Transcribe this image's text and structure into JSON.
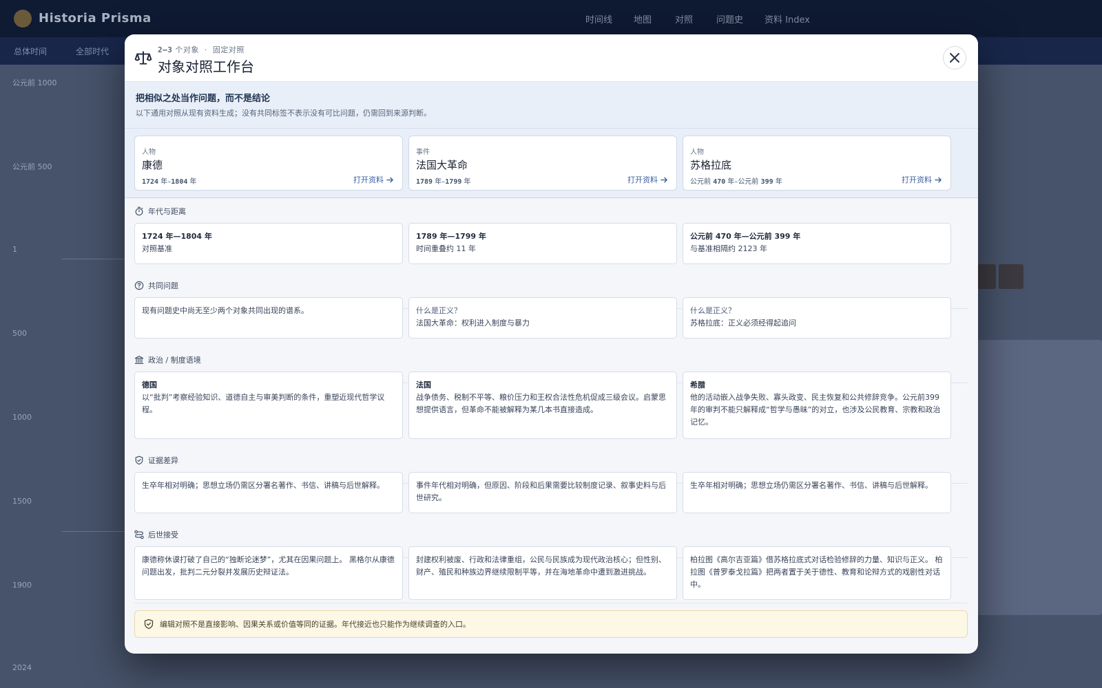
{
  "background": {
    "app_name": "Historia Prisma",
    "nav": [
      "时间线",
      "地图",
      "对照",
      "问题史",
      "资料 Index"
    ],
    "subnav": [
      "总体时间",
      "全部时代"
    ],
    "year_labels": [
      "公元前 1000",
      "公元前 500",
      "1",
      "500",
      "1000",
      "1500",
      "1900",
      "2024"
    ]
  },
  "modal": {
    "eyebrow_count": "2–3",
    "eyebrow_unit": "个对象",
    "eyebrow_sep": "·",
    "eyebrow_mode": "固定对照",
    "title": "对象对照工作台",
    "notice": {
      "title": "把相似之处当作问题，而不是结论",
      "subtitle": "以下通用对照从现有资料生成；没有共同标签不表示没有可比问题，仍需回到来源判断。"
    },
    "open_label": "打开资料",
    "subjects": [
      {
        "type": "人物",
        "name": "康德",
        "start_prefix": "",
        "start": "1724",
        "sep1": " 年–",
        "end_prefix": "",
        "end": "1804",
        "sep2": " 年"
      },
      {
        "type": "事件",
        "name": "法国大革命",
        "start_prefix": "",
        "start": "1789",
        "sep1": " 年–",
        "end_prefix": "",
        "end": "1799",
        "sep2": " 年"
      },
      {
        "type": "人物",
        "name": "苏格拉底",
        "start_prefix": "公元前 ",
        "start": "470",
        "sep1": " 年–",
        "end_prefix": "公元前 ",
        "end": "399",
        "sep2": " 年"
      }
    ],
    "sections": {
      "chronology": {
        "title": "年代与距离",
        "cells": [
          {
            "range": "1724 年—1804 年",
            "note": "对照基准"
          },
          {
            "range": "1789 年—1799 年",
            "note": "时间重叠约 11 年"
          },
          {
            "range": "公元前 470 年—公元前 399 年",
            "note": "与基准相隔约 2123 年"
          }
        ]
      },
      "questions": {
        "title": "共同问题",
        "cells": [
          {
            "question": "",
            "text": "现有问题史中尚无至少两个对象共同出现的谱系。"
          },
          {
            "question": "什么是正义？",
            "text": "法国大革命：权利进入制度与暴力"
          },
          {
            "question": "什么是正义？",
            "text": "苏格拉底：正义必须经得起追问"
          }
        ]
      },
      "context": {
        "title": "政治 / 制度语境",
        "cells": [
          {
            "place": "德国",
            "text": "以“批判”考察经验知识、道德自主与审美判断的条件，重塑近现代哲学议程。"
          },
          {
            "place": "法国",
            "text": "战争债务、税制不平等、粮价压力和王权合法性危机促成三级会议。启蒙思想提供语言，但革命不能被解释为某几本书直接造成。"
          },
          {
            "place": "希腊",
            "text": "他的活动嵌入战争失败、寡头政变、民主恢复和公共修辞竞争。公元前399年的审判不能只解释成“哲学与愚昧”的对立，也涉及公民教育、宗教和政治记忆。"
          }
        ]
      },
      "evidence": {
        "title": "证据差异",
        "cells": [
          {
            "text": "生卒年相对明确；思想立场仍需区分署名著作、书信、讲稿与后世解释。"
          },
          {
            "text": "事件年代相对明确，但原因、阶段和后果需要比较制度记录、叙事史料与后世研究。"
          },
          {
            "text": "生卒年相对明确；思想立场仍需区分署名著作、书信、讲稿与后世解释。"
          }
        ]
      },
      "reception": {
        "title": "后世接受",
        "cells": [
          {
            "text": "康德称休谟打破了自己的“独断论迷梦”，尤其在因果问题上。 黑格尔从康德问题出发，批判二元分裂并发展历史辩证法。"
          },
          {
            "text": "封建权利被废、行政和法律重组，公民与民族成为现代政治核心；但性别、财产、殖民和种族边界继续限制平等，并在海地革命中遭到激进挑战。"
          },
          {
            "text": "柏拉图《高尔吉亚篇》借苏格拉底式对话检验修辞的力量、知识与正义。 柏拉图《普罗泰戈拉篇》把两者置于关于德性、教育和论辩方式的戏剧性对话中。"
          }
        ]
      }
    },
    "footer": "编辑对照不是直接影响、因果关系或价值等同的证据。年代接近也只能作为继续调查的入口。"
  },
  "colors": {
    "accent": "#3d5f9e",
    "backdrop": "#2b3449",
    "notice_bg": "#e9eff8",
    "footer_bg": "#fdf7e6"
  }
}
